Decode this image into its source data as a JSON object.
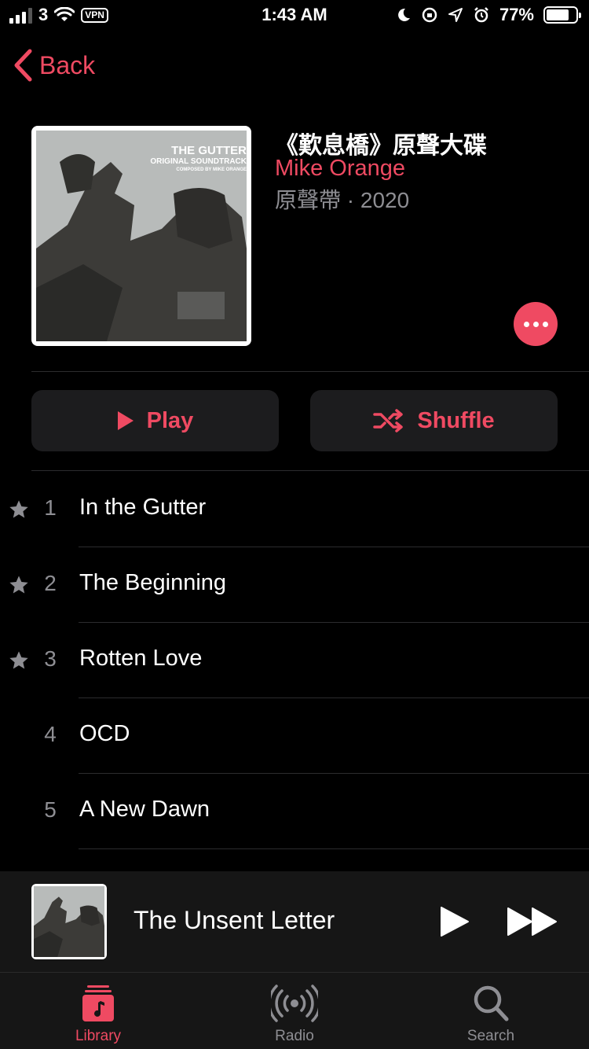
{
  "status_bar": {
    "carrier": "3",
    "vpn": "VPN",
    "time": "1:43 AM",
    "battery": "77%"
  },
  "nav": {
    "back_label": "Back"
  },
  "album": {
    "title": "《歎息橋》原聲大碟",
    "artist": "Mike Orange",
    "meta": "原聲帶 · 2020",
    "cover_line1": "THE GUTTER",
    "cover_line2": "ORIGINAL SOUNDTRACK",
    "cover_line3": "COMPOSED BY MIKE ORANGE"
  },
  "actions": {
    "play": "Play",
    "shuffle": "Shuffle"
  },
  "tracks": [
    {
      "num": "1",
      "title": "In the Gutter",
      "starred": true
    },
    {
      "num": "2",
      "title": "The Beginning",
      "starred": true
    },
    {
      "num": "3",
      "title": "Rotten Love",
      "starred": true
    },
    {
      "num": "4",
      "title": "OCD",
      "starred": false
    },
    {
      "num": "5",
      "title": "A New Dawn",
      "starred": false
    }
  ],
  "mini_player": {
    "title": "The Unsent Letter"
  },
  "tabs": [
    {
      "label": "Library",
      "icon": "library-icon",
      "active": true
    },
    {
      "label": "Radio",
      "icon": "radio-icon",
      "active": false
    },
    {
      "label": "Search",
      "icon": "search-icon",
      "active": false
    }
  ],
  "colors": {
    "accent": "#ef4a62",
    "secondary_text": "#8e8e93",
    "button_bg": "#1c1c1e"
  }
}
